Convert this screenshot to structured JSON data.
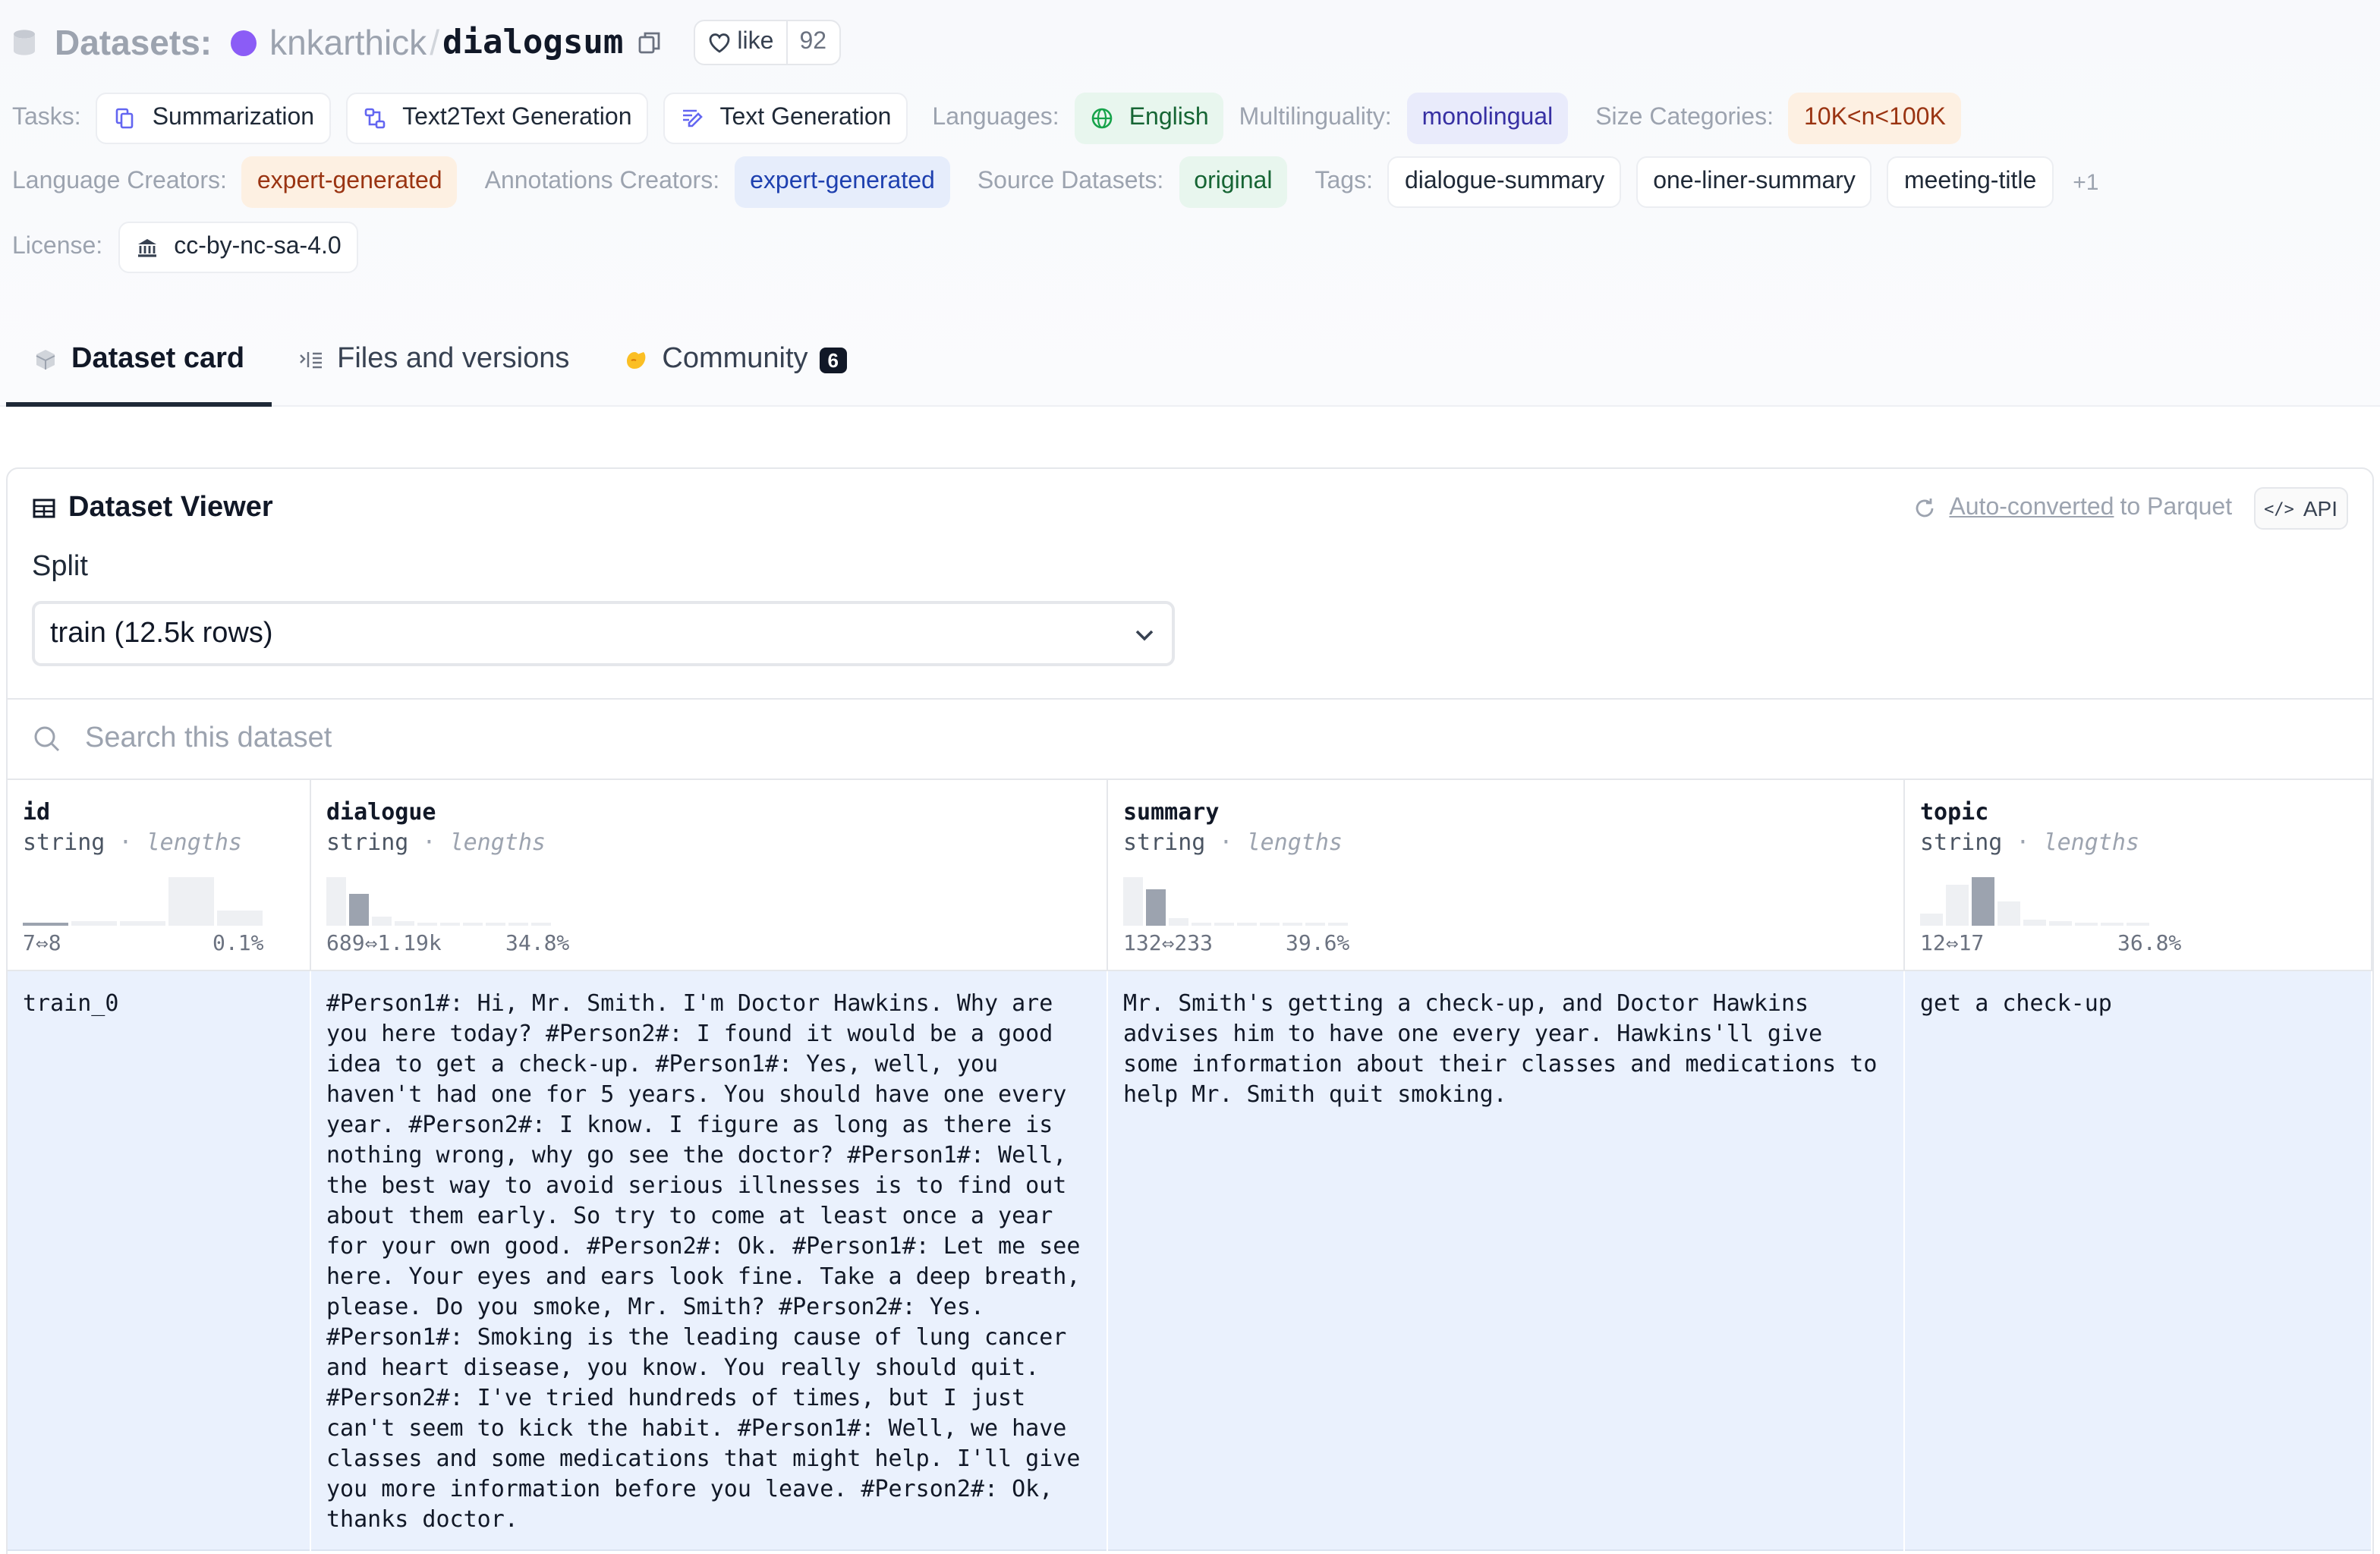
{
  "header": {
    "datasets_label": "Datasets:",
    "owner": "knkarthick",
    "separator": "/",
    "repo": "dialogsum",
    "like_label": "like",
    "like_count": "92"
  },
  "tags": {
    "tasks_label": "Tasks:",
    "tasks": [
      "Summarization",
      "Text2Text Generation",
      "Text Generation"
    ],
    "languages_label": "Languages:",
    "language": "English",
    "multilinguality_label": "Multilinguality:",
    "multilinguality": "monolingual",
    "size_label": "Size Categories:",
    "size": "10K<n<100K",
    "lang_creators_label": "Language Creators:",
    "lang_creators": "expert-generated",
    "ann_creators_label": "Annotations Creators:",
    "ann_creators": "expert-generated",
    "source_label": "Source Datasets:",
    "source": "original",
    "tags_label": "Tags:",
    "tag_list": [
      "dialogue-summary",
      "one-liner-summary",
      "meeting-title"
    ],
    "more": "+1",
    "license_label": "License:",
    "license": "cc-by-nc-sa-4.0"
  },
  "tabs": [
    {
      "label": "Dataset card"
    },
    {
      "label": "Files and versions"
    },
    {
      "label": "Community",
      "badge": "6"
    }
  ],
  "viewer": {
    "title": "Dataset Viewer",
    "auto_converted": "Auto-converted",
    "to_parquet": "to Parquet",
    "api": "API",
    "split_label": "Split",
    "split_value": "train (12.5k rows)",
    "search_placeholder": "Search this dataset"
  },
  "columns": [
    {
      "name": "id",
      "type": "string",
      "stat": "lengths",
      "range": "7⇔8",
      "pct": "0.1%",
      "hist": [
        0.05,
        0.08,
        0.1,
        1.0,
        0.3
      ],
      "highlight": 0
    },
    {
      "name": "dialogue",
      "type": "string",
      "stat": "lengths",
      "range": "689⇔1.19k",
      "pct": "34.8%",
      "hist": [
        1.0,
        0.65,
        0.18,
        0.08,
        0.05,
        0.05,
        0.04,
        0.04,
        0.03,
        0.03
      ],
      "highlight": 1
    },
    {
      "name": "summary",
      "type": "string",
      "stat": "lengths",
      "range": "132⇔233",
      "pct": "39.6%",
      "hist": [
        1.0,
        0.75,
        0.15,
        0.07,
        0.05,
        0.04,
        0.04,
        0.03,
        0.03,
        0.03
      ],
      "highlight": 1
    },
    {
      "name": "topic",
      "type": "string",
      "stat": "lengths",
      "range": "12⇔17",
      "pct": "36.8%",
      "hist": [
        0.25,
        0.85,
        1.0,
        0.5,
        0.12,
        0.08,
        0.05,
        0.04,
        0.03
      ],
      "highlight": 2
    }
  ],
  "rows": [
    {
      "id": "train_0",
      "dialogue": "#Person1#: Hi, Mr. Smith. I'm Doctor Hawkins. Why are you here today? #Person2#: I found it would be a good idea to get a check-up. #Person1#: Yes, well, you haven't had one for 5 years. You should have one every year. #Person2#: I know. I figure as long as there is nothing wrong, why go see the doctor? #Person1#: Well, the best way to avoid serious illnesses is to find out about them early. So try to come at least once a year for your own good. #Person2#: Ok. #Person1#: Let me see here. Your eyes and ears look fine. Take a deep breath, please. Do you smoke, Mr. Smith? #Person2#: Yes. #Person1#: Smoking is the leading cause of lung cancer and heart disease, you know. You really should quit. #Person2#: I've tried hundreds of times, but I just can't seem to kick the habit. #Person1#: Well, we have classes and some medications that might help. I'll give you more information before you leave. #Person2#: Ok, thanks doctor.",
      "summary": "Mr. Smith's getting a check-up, and Doctor Hawkins advises him to have one every year. Hawkins'll give some information about their classes and medications to help Mr. Smith quit smoking.",
      "topic": "get a check-up"
    }
  ]
}
